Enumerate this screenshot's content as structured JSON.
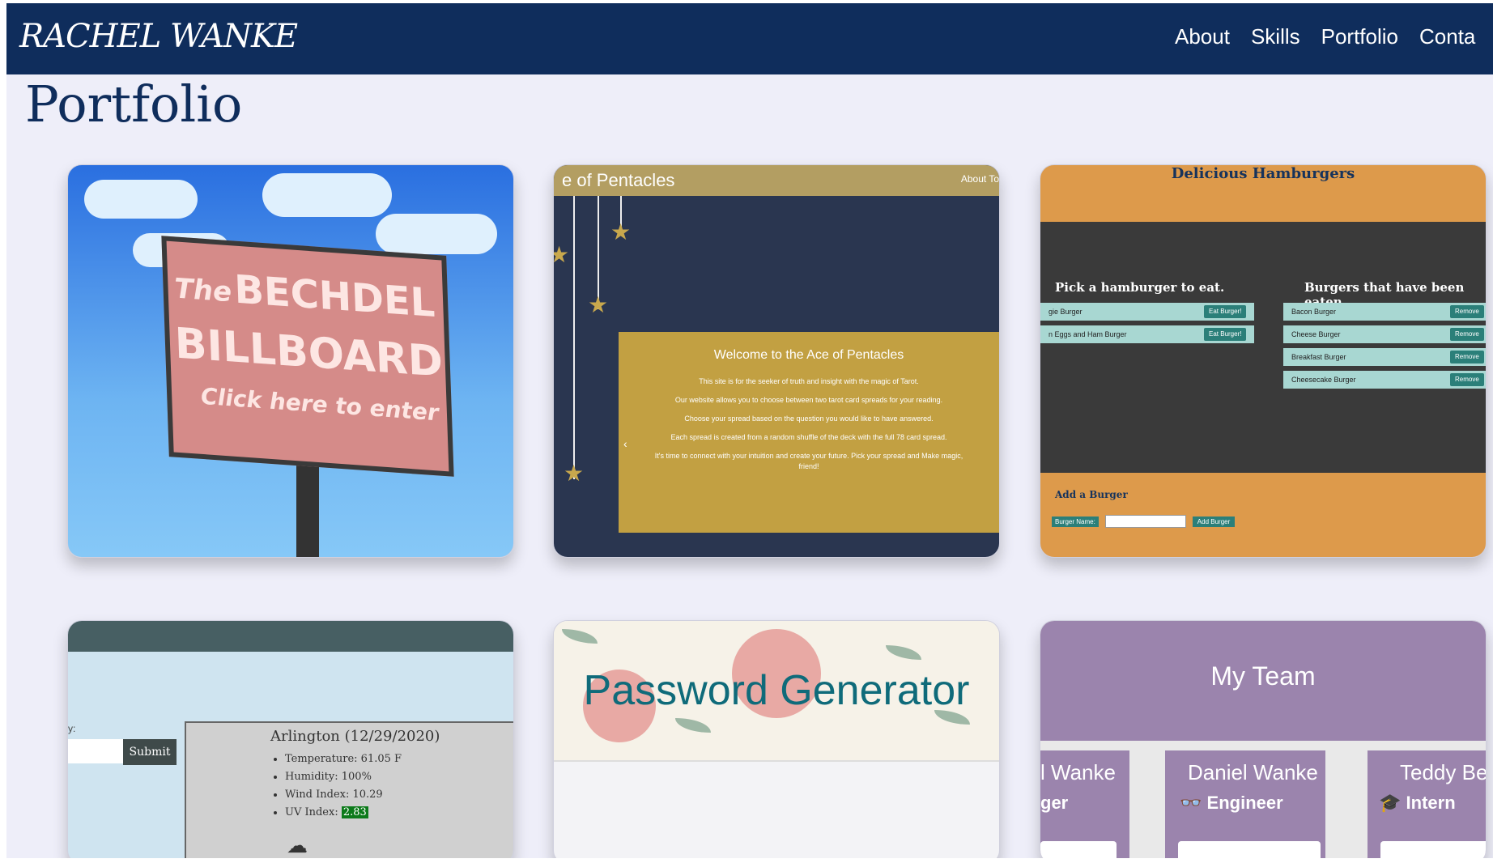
{
  "header": {
    "logo": "RACHEL WANKE",
    "nav": [
      "About",
      "Skills",
      "Portfolio",
      "Conta"
    ]
  },
  "page": {
    "title": "Portfolio"
  },
  "cards": {
    "bechdel": {
      "line1": "The",
      "line2": "BECHDEL",
      "line3": "BILLBOARD",
      "line4": "Click here to enter"
    },
    "tarot": {
      "title": "e of Pentacles",
      "about": "About To",
      "heading": "Welcome to the Ace of Pentacles",
      "lines": [
        "This site is for the seeker of truth and insight with the magic of Tarot.",
        "Our website allows you to choose between two tarot card spreads for your reading.",
        "Choose your spread based on the question you would like to have answered.",
        "Each spread is created from a random shuffle of the deck with the full 78 card spread.",
        "It's time to connect with your intuition and create your future. Pick your spread and Make magic,",
        "friend!"
      ],
      "arrow": "‹"
    },
    "burgers": {
      "title": "Delicious Hamburgers",
      "left_heading": "Pick a hamburger to eat.",
      "right_heading": "Burgers that have been eaten.",
      "left_items": [
        "gie Burger",
        "n Eggs and Ham Burger"
      ],
      "eat_label": "Eat Burger!",
      "right_items": [
        "Bacon Burger",
        "Cheese Burger",
        "Breakfast Burger",
        "Cheesecake Burger"
      ],
      "remove_label": "Remove",
      "add_heading": "Add a Burger",
      "name_label": "Burger Name:",
      "add_button": "Add Burger"
    },
    "weather": {
      "colon": "y:",
      "submit": "Submit",
      "city": "Arlington (12/29/2020)",
      "temp": "Temperature: 61.05 F",
      "humidity": "Humidity: 100%",
      "wind": "Wind Index: 10.29",
      "uv_label": "UV Index:",
      "uv_value": "2.83"
    },
    "password": {
      "title": "Password Generator"
    },
    "team": {
      "title": "My Team",
      "members": [
        {
          "name": "l Wanke",
          "role": "ger",
          "icon": ""
        },
        {
          "name": "Daniel Wanke",
          "role": "Engineer",
          "icon": "glasses-icon"
        },
        {
          "name": "Teddy Be",
          "role": "Intern",
          "icon": "graduate-icon"
        }
      ]
    }
  }
}
